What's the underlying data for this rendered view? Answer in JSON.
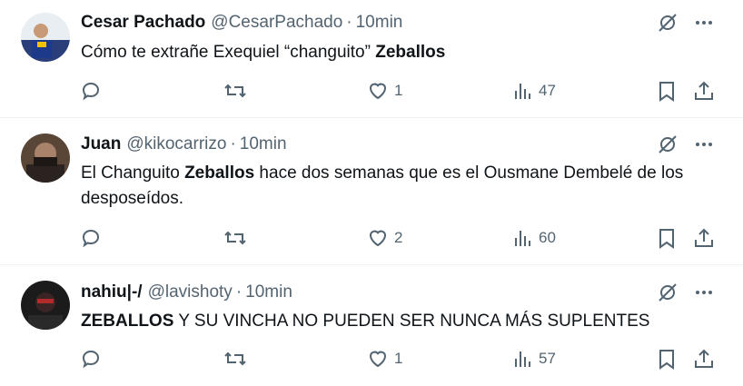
{
  "tweets": [
    {
      "author": "Cesar Pachado",
      "handle": "@CesarPachado",
      "time": "10min",
      "text_before": "Cómo te extrañe Exequiel “changuito” ",
      "text_bold": "Zeballos",
      "text_after": "",
      "likes": "1",
      "views": "47"
    },
    {
      "author": "Juan",
      "handle": "@kikocarrizo",
      "time": "10min",
      "text_before": "El Changuito ",
      "text_bold": "Zeballos",
      "text_after": " hace dos semanas que es el Ousmane Dembelé de los desposeídos.",
      "likes": "2",
      "views": "60"
    },
    {
      "author": "nahiu|-/",
      "handle": "@lavishoty",
      "time": "10min",
      "text_before": "",
      "text_bold": "ZEBALLOS",
      "text_after": " Y SU VINCHA NO PUEDEN SER NUNCA MÁS SUPLENTES",
      "likes": "1",
      "views": "57"
    }
  ],
  "separator": "·",
  "icons": [
    "grok-icon",
    "more-icon",
    "reply-icon",
    "retweet-icon",
    "like-icon",
    "views-icon",
    "bookmark-icon",
    "share-icon"
  ]
}
